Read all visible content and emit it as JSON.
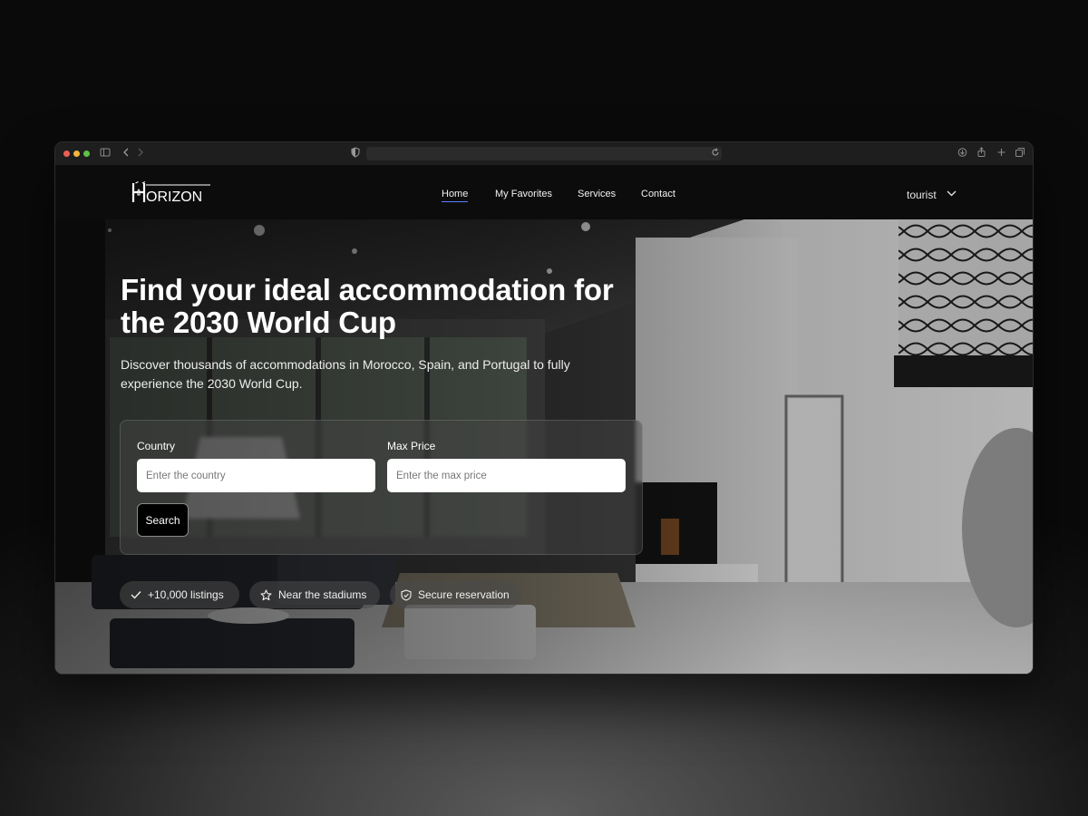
{
  "site": {
    "logo_text": "ORIZON",
    "logo_letter": "H",
    "nav": [
      {
        "label": "Home",
        "active": true
      },
      {
        "label": "My Favorites",
        "active": false
      },
      {
        "label": "Services",
        "active": false
      },
      {
        "label": "Contact",
        "active": false
      }
    ],
    "user_label": "tourist"
  },
  "hero": {
    "title_line1": "Find your ideal accommodation for",
    "title_line2": "the 2030 World Cup",
    "subtitle_line1": "Discover thousands of accommodations in Morocco, Spain, and Portugal to fully",
    "subtitle_line2": "experience the 2030 World Cup."
  },
  "search": {
    "country_label": "Country",
    "country_placeholder": "Enter the country",
    "country_value": "",
    "price_label": "Max Price",
    "price_placeholder": "Enter the max price",
    "price_value": "",
    "button_label": "Search"
  },
  "badges": [
    {
      "label": "+10,000 listings",
      "icon": "check-icon"
    },
    {
      "label": "Near the stadiums",
      "icon": "star-icon"
    },
    {
      "label": "Secure reservation",
      "icon": "shield-icon"
    }
  ],
  "colors": {
    "accent_underline": "#5b7cff",
    "nav_background": "#0c0c0c",
    "button_background": "#000000"
  }
}
